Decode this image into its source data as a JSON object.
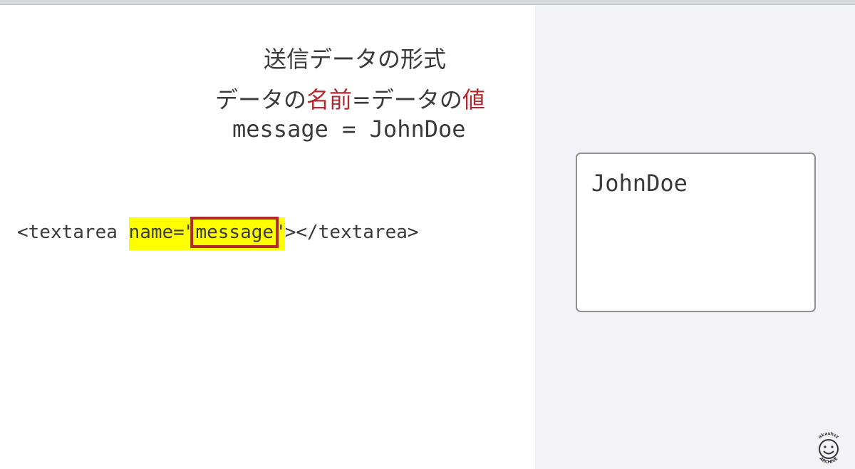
{
  "slide": {
    "title": "送信データの形式",
    "formula": {
      "part1": "データの",
      "name_word": "名前",
      "part2": "=データの",
      "value_word": "値"
    },
    "example": "message = JohnDoe"
  },
  "code": {
    "open_tag": "<textarea ",
    "attr_name": "name=\"",
    "attr_value": "message",
    "attr_close": "\"",
    "close_tag": "></textarea>"
  },
  "demo": {
    "textarea_value": "JohnDoe"
  },
  "watermark": {
    "top_text": "akashzz",
    "bottom_text": "ARCHIVE"
  },
  "colors": {
    "accent": "#b3282d",
    "highlight": "#ffff00",
    "pane_bg": "#f2f2f7"
  }
}
